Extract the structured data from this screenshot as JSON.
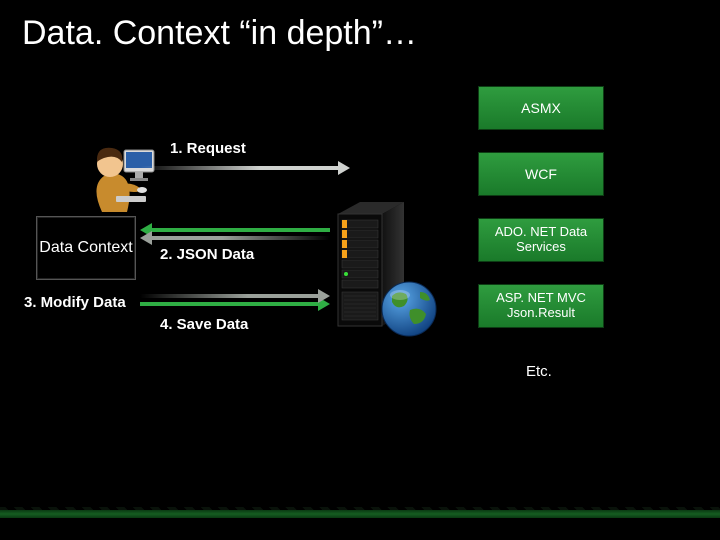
{
  "title": "Data. Context “in depth”…",
  "steps": {
    "request": "1. Request",
    "json": "2. JSON Data",
    "modify": "3. Modify Data",
    "save": "4. Save Data"
  },
  "left_box": "Data Context",
  "right_boxes": {
    "asmx": "ASMX",
    "wcf": "WCF",
    "ado": "ADO. NET Data Services",
    "mvc": "ASP. NET MVC Json.Result",
    "etc": "Etc."
  },
  "icons": {
    "person": "person-at-desk",
    "server": "server-rack",
    "globe": "globe"
  },
  "colors": {
    "green": "#2f9c3f",
    "arrow_green": "#2fae44",
    "arrow_grey": "#cfd2cf"
  }
}
